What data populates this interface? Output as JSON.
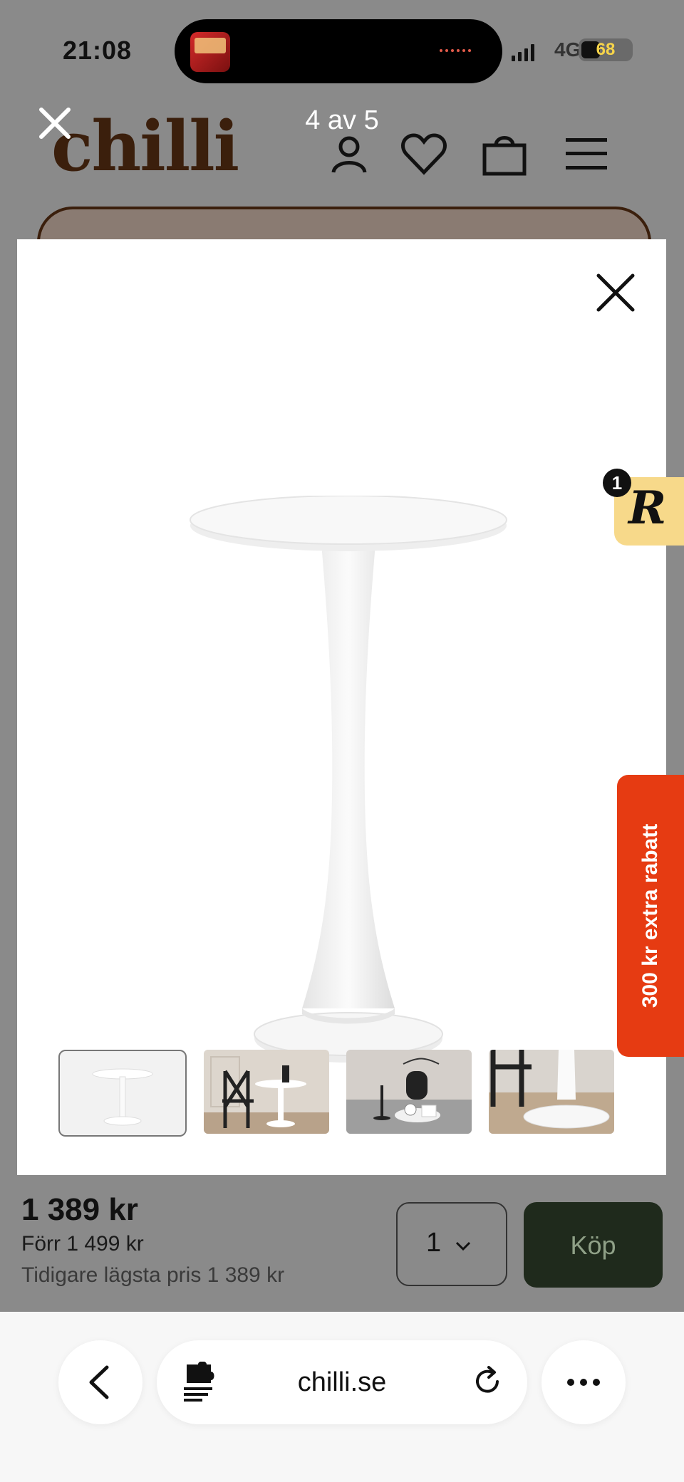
{
  "status_bar": {
    "time": "21:08",
    "network": "4G",
    "battery": "68"
  },
  "viewer": {
    "counter": "4 av 5"
  },
  "site": {
    "logo": "chilli"
  },
  "side_badges": {
    "reco_count": "1",
    "reco_letter": "R",
    "promo": "300 kr extra rabatt"
  },
  "product_bar": {
    "price": "1 389 kr",
    "previous_price": "Förr 1 499 kr",
    "lowest_price": "Tidigare lägsta pris 1 389 kr",
    "quantity": "1",
    "buy_label": "Köp"
  },
  "browser": {
    "url": "chilli.se"
  },
  "colors": {
    "brand": "#3b1f0c",
    "promo": "#e63b12",
    "buy_button": "#1f2a1c",
    "badge": "#f7d98a"
  }
}
